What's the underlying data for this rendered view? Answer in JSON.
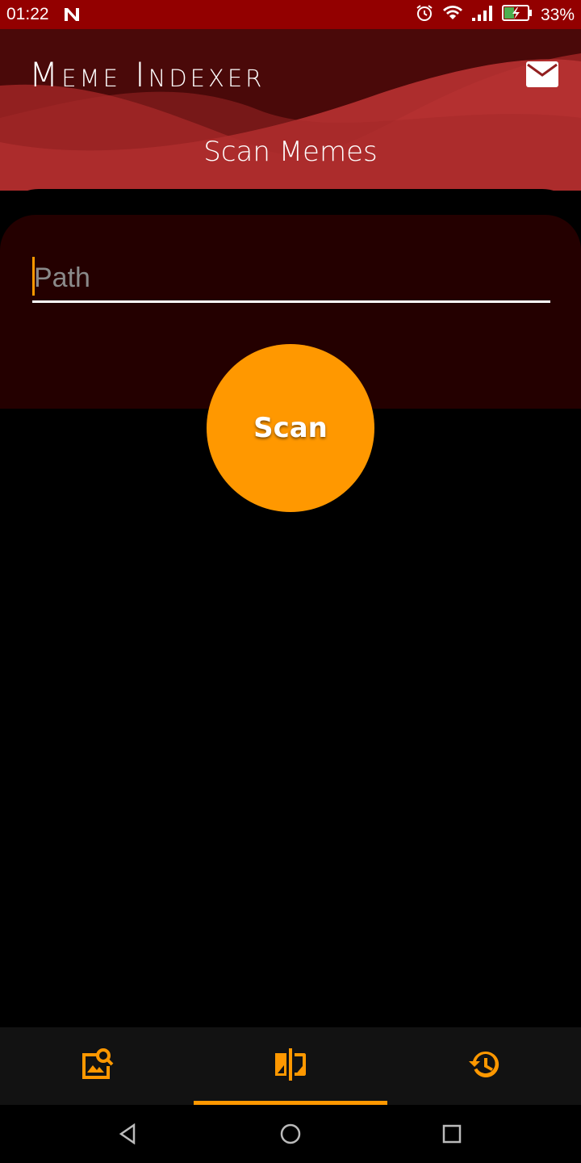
{
  "status_bar": {
    "time": "01:22",
    "battery_percent": "33%",
    "icons": [
      "notification-n-icon",
      "alarm-icon",
      "wifi-icon",
      "signal-icon",
      "battery-charging-icon"
    ]
  },
  "header": {
    "app_title": "Meme Indexer",
    "page_title": "Scan Memes",
    "mail_icon": "mail-icon"
  },
  "form": {
    "path_placeholder": "Path",
    "path_value": "",
    "scan_label": "Scan"
  },
  "bottom_nav": {
    "items": [
      {
        "icon": "image-search-icon",
        "active": false
      },
      {
        "icon": "compare-icon",
        "active": true
      },
      {
        "icon": "history-icon",
        "active": false
      }
    ]
  },
  "system_nav": [
    "back-icon",
    "home-icon",
    "recents-icon"
  ],
  "colors": {
    "accent": "#ff9800",
    "status_bar": "#930000",
    "header_bg": "#4a0909",
    "card_bg": "#240000",
    "nav_bg": "#121212"
  }
}
